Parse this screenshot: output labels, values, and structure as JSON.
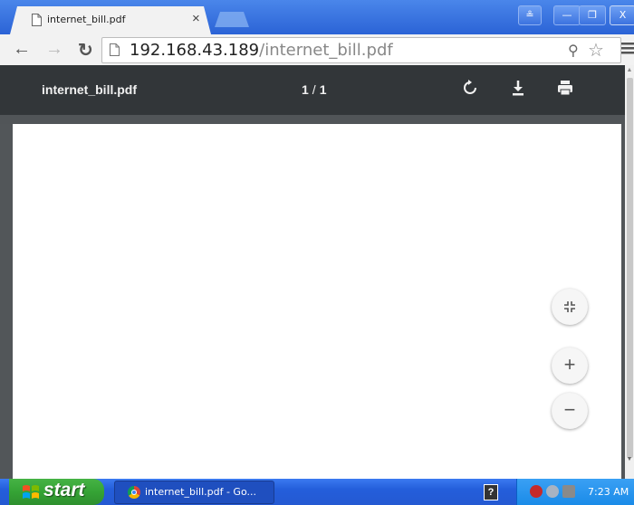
{
  "browser": {
    "tab": {
      "title": "internet_bill.pdf",
      "close_glyph": "×"
    },
    "window_buttons": {
      "user": "≗",
      "minimize": "—",
      "maximize": "❐",
      "close": "X"
    },
    "address": {
      "host": "192.168.43.189",
      "path": "/internet_bill.pdf"
    },
    "icons": [
      "back-arrow-icon",
      "forward-arrow-icon",
      "reload-icon",
      "page-icon",
      "zoom-icon",
      "star-icon",
      "menu-icon"
    ]
  },
  "pdf_viewer": {
    "title": "internet_bill.pdf",
    "current_page": "1",
    "total_pages": "1",
    "page_separator": "/",
    "zoom_in_glyph": "+",
    "zoom_out_glyph": "−",
    "colors": {
      "header": "#323639",
      "background": "#525659",
      "page": "#ffffff"
    }
  },
  "taskbar": {
    "start_label": "start",
    "task_label": "internet_bill.pdf - Go...",
    "clock": "7:23 AM",
    "help_glyph": "?"
  }
}
